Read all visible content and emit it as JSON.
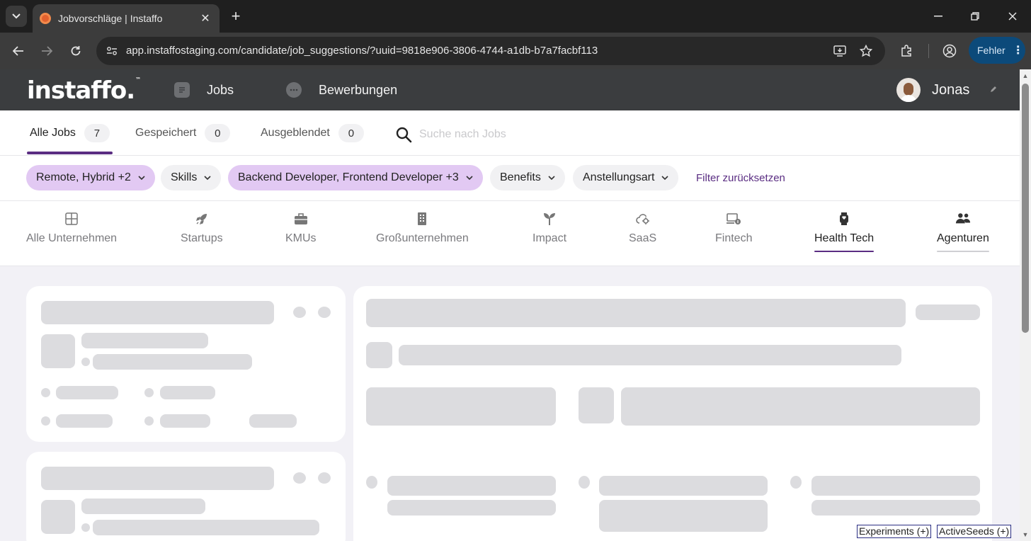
{
  "browser": {
    "tab_title": "Jobvorschläge | Instaffo",
    "tab_close": "✕",
    "new_tab": "+",
    "url": "app.instaffostaging.com/candidate/job_suggestions/?uuid=9818e906-3806-4744-a1db-b7a7facbf113",
    "error_label": "Fehler",
    "error_menu": "⋮"
  },
  "header": {
    "logo": "instaffo",
    "logo_mark": "™",
    "nav": [
      {
        "label": "Jobs"
      },
      {
        "label": "Bewerbungen"
      }
    ],
    "user_name": "Jonas"
  },
  "tabs": [
    {
      "label": "Alle Jobs",
      "count": "7"
    },
    {
      "label": "Gespeichert",
      "count": "0"
    },
    {
      "label": "Ausgeblendet",
      "count": "0"
    }
  ],
  "search": {
    "placeholder": "Suche nach Jobs"
  },
  "filters": [
    {
      "label": "Remote, Hybrid +2",
      "selected": true
    },
    {
      "label": "Skills",
      "selected": false
    },
    {
      "label": "Backend Developer, Frontend Developer +3",
      "selected": true
    },
    {
      "label": "Benefits",
      "selected": false
    },
    {
      "label": "Anstellungsart",
      "selected": false
    }
  ],
  "reset_filters": "Filter zurücksetzen",
  "categories": [
    {
      "label": "Alle Unternehmen",
      "icon": "grid-icon"
    },
    {
      "label": "Startups",
      "icon": "rocket-icon"
    },
    {
      "label": "KMUs",
      "icon": "briefcase-icon"
    },
    {
      "label": "Großunternehmen",
      "icon": "building-icon"
    },
    {
      "label": "Impact",
      "icon": "sprout-icon"
    },
    {
      "label": "SaaS",
      "icon": "cloud-gear-icon"
    },
    {
      "label": "Fintech",
      "icon": "laptop-coin-icon"
    },
    {
      "label": "Health Tech",
      "icon": "smartwatch-icon"
    },
    {
      "label": "Agenturen",
      "icon": "people-icon"
    }
  ],
  "active_category": "Health Tech",
  "debug": {
    "experiments": "Experiments (+)",
    "active_seeds": "ActiveSeeds (+)"
  },
  "colors": {
    "brand": "#5a2d82",
    "chip_selected": "#e2c9f3",
    "header_bg": "#3b3d3f",
    "skeleton": "#dcdcdf"
  }
}
